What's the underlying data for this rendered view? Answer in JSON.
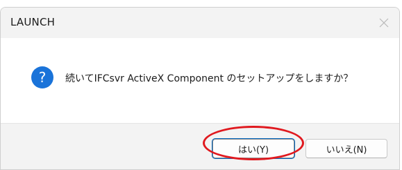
{
  "dialog": {
    "title": "LAUNCH",
    "message": "続いてIFCsvr ActiveX Component のセットアップをしますか？",
    "buttons": {
      "yes_label": "はい(Y)",
      "no_label": "いいえ(N)"
    }
  },
  "icons": {
    "question": "question-icon",
    "close": "close-icon"
  },
  "colors": {
    "question_icon": "#1a73d9",
    "highlight_ring": "#e0191f",
    "focus_outline": "#0067c0"
  }
}
